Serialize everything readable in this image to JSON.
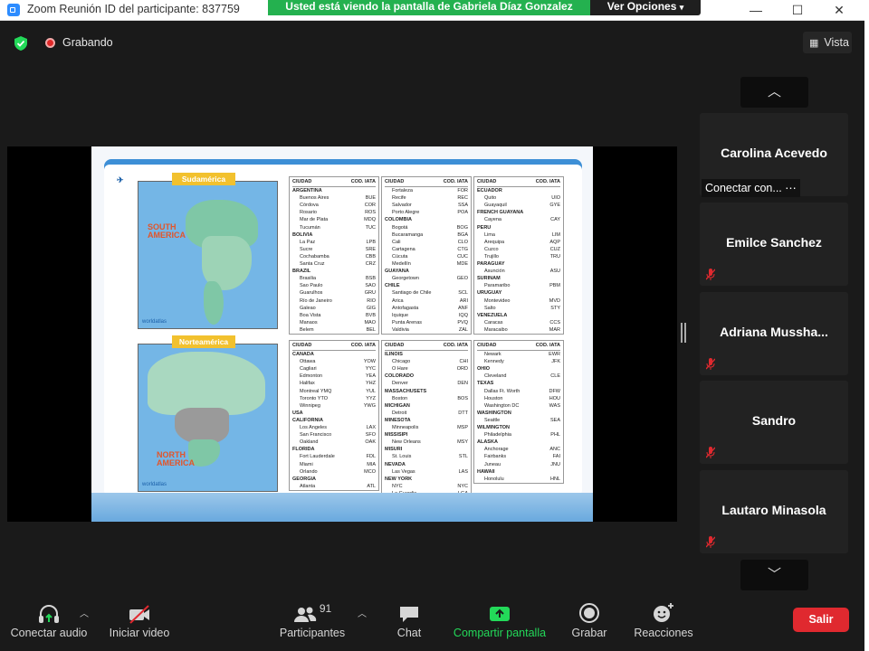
{
  "window": {
    "title": "Zoom Reunión ID del participante: 837759",
    "minimize": "—",
    "maximize": "☐",
    "close": "✕"
  },
  "share_banner": {
    "text": "Usted está viendo la pantalla de Gabriela Díaz Gonzalez",
    "view_options": "Ver Opciones"
  },
  "top": {
    "recording_label": "Grabando",
    "view_label": "Vista"
  },
  "slide": {
    "map_sa_tag": "Sudamérica",
    "map_sa_name_line1": "SOUTH",
    "map_sa_name_line2": "AMERICA",
    "map_na_tag": "Norteamérica",
    "map_na_name_line1": "NORTH",
    "map_na_name_line2": "AMERICA",
    "worldatlas": "worldatlas",
    "header_city": "CIUDAD",
    "header_code": "COD. IATA",
    "tables": [
      [
        [
          "c",
          "ARGENTINA",
          ""
        ],
        [
          "t",
          "Buenos Aires",
          "BUE"
        ],
        [
          "t",
          "Córdova",
          "COR"
        ],
        [
          "t",
          "Rosario",
          "ROS"
        ],
        [
          "t",
          "Mar de Plata",
          "MDQ"
        ],
        [
          "t",
          "Tucumán",
          "TUC"
        ],
        [
          "c",
          "BOLIVIA",
          ""
        ],
        [
          "t",
          "La Paz",
          "LPB"
        ],
        [
          "t",
          "Sucre",
          "SRE"
        ],
        [
          "t",
          "Cochabamba",
          "CBB"
        ],
        [
          "t",
          "Santa Cruz",
          "CRZ"
        ],
        [
          "c",
          "BRAZIL",
          ""
        ],
        [
          "t",
          "Brasilia",
          "BSB"
        ],
        [
          "t",
          "Sao Paulo",
          "SAO"
        ],
        [
          "t",
          "Guarulhos",
          "GRU"
        ],
        [
          "t",
          "Río de Janeiro",
          "RIO"
        ],
        [
          "t",
          "Galeao",
          "GIG"
        ],
        [
          "t",
          "Boa Vista",
          "BVB"
        ],
        [
          "t",
          "Manaos",
          "MAO"
        ],
        [
          "t",
          "Belem",
          "BEL"
        ]
      ],
      [
        [
          "t",
          "Fortaleza",
          "FOR"
        ],
        [
          "t",
          "Recife",
          "REC"
        ],
        [
          "t",
          "Salvador",
          "SSA"
        ],
        [
          "t",
          "Porto Alegre",
          "POA"
        ],
        [
          "c",
          "COLOMBIA",
          ""
        ],
        [
          "t",
          "Bogotá",
          "BOG"
        ],
        [
          "t",
          "Bucaramanga",
          "BGA"
        ],
        [
          "t",
          "Cali",
          "CLO"
        ],
        [
          "t",
          "Cartagena",
          "CTG"
        ],
        [
          "t",
          "Cúcuta",
          "CUC"
        ],
        [
          "t",
          "Medellín",
          "MDE"
        ],
        [
          "c",
          "GUAYANA",
          ""
        ],
        [
          "t",
          "Georgetown",
          "GEO"
        ],
        [
          "c",
          "CHILE",
          ""
        ],
        [
          "t",
          "Santiago de Chile",
          "SCL"
        ],
        [
          "t",
          "Arica",
          "ARI"
        ],
        [
          "t",
          "Antofagasta",
          "ANF"
        ],
        [
          "t",
          "Iquique",
          "IQQ"
        ],
        [
          "t",
          "Punta Arenas",
          "PVQ"
        ],
        [
          "t",
          "Valdivia",
          "ZAL"
        ]
      ],
      [
        [
          "c",
          "ECUADOR",
          ""
        ],
        [
          "t",
          "Quito",
          "UIO"
        ],
        [
          "t",
          "Guayaquil",
          "GYE"
        ],
        [
          "c",
          "FRENCH GUAYANA",
          ""
        ],
        [
          "t",
          "Cayena",
          "CAY"
        ],
        [
          "c",
          "PERU",
          ""
        ],
        [
          "t",
          "Lima",
          "LIM"
        ],
        [
          "t",
          "Arequipa",
          "AQP"
        ],
        [
          "t",
          "Cuzco",
          "CUZ"
        ],
        [
          "t",
          "Trujillo",
          "TRU"
        ],
        [
          "c",
          "PARAGUAY",
          ""
        ],
        [
          "t",
          "Asunción",
          "ASU"
        ],
        [
          "c",
          "SURINAM",
          ""
        ],
        [
          "t",
          "Paramaribo",
          "PBM"
        ],
        [
          "c",
          "URUGUAY",
          ""
        ],
        [
          "t",
          "Montevideo",
          "MVD"
        ],
        [
          "t",
          "Salto",
          "STY"
        ],
        [
          "c",
          "VENEZUELA",
          ""
        ],
        [
          "t",
          "Caracas",
          "CCS"
        ],
        [
          "t",
          "Maracaibo",
          "MAR"
        ]
      ],
      [
        [
          "c",
          "CANADA",
          ""
        ],
        [
          "t",
          "Ottawa",
          "YOW"
        ],
        [
          "t",
          "Cagliari",
          "YYC"
        ],
        [
          "t",
          "Edmonton",
          "YEA"
        ],
        [
          "t",
          "Halifax",
          "YHZ"
        ],
        [
          "t",
          "Montreal   YMQ",
          "YUL"
        ],
        [
          "t",
          "Toronto   YTO",
          "YYZ"
        ],
        [
          "t",
          "Winnipeg",
          "YWG"
        ],
        [
          "c",
          "USA",
          ""
        ],
        [
          "c",
          "CALIFORNIA",
          ""
        ],
        [
          "t",
          "Los Angeles",
          "LAX"
        ],
        [
          "t",
          "San Francisco",
          "SFO"
        ],
        [
          "t",
          "Oakland",
          "OAK"
        ],
        [
          "c",
          "FLORIDA",
          ""
        ],
        [
          "t",
          "Fort Lauderdale",
          "FDL"
        ],
        [
          "t",
          "Miami",
          "MIA"
        ],
        [
          "t",
          "Orlando",
          "MCO"
        ],
        [
          "c",
          "GEORGIA",
          ""
        ],
        [
          "t",
          "Atlanta",
          "ATL"
        ]
      ],
      [
        [
          "c",
          "ILINOIS",
          ""
        ],
        [
          "t",
          "Chicago",
          "CHI"
        ],
        [
          "t",
          "O Hare",
          "ORD"
        ],
        [
          "c",
          "COLORADO",
          ""
        ],
        [
          "t",
          "Denver",
          "DEN"
        ],
        [
          "c",
          "MASSACHUSETS",
          ""
        ],
        [
          "t",
          "Boston",
          "BOS"
        ],
        [
          "c",
          "MICHIGAN",
          ""
        ],
        [
          "t",
          "Detroit",
          "DTT"
        ],
        [
          "c",
          "MINESOTA",
          ""
        ],
        [
          "t",
          "Minneapolis",
          "MSP"
        ],
        [
          "c",
          "MISSISIPI",
          ""
        ],
        [
          "t",
          "New Orleans",
          "MSY"
        ],
        [
          "c",
          "MISURI",
          ""
        ],
        [
          "t",
          "St. Louis",
          "STL"
        ],
        [
          "c",
          "NEVADA",
          ""
        ],
        [
          "t",
          "Las Vegas",
          "LAS"
        ],
        [
          "c",
          "NEW YORK",
          ""
        ],
        [
          "t",
          "NYC",
          "NYC"
        ],
        [
          "t",
          "La Guardia",
          "LGA"
        ]
      ],
      [
        [
          "t",
          "Newark",
          "EWR"
        ],
        [
          "t",
          "Kennedy",
          "JFK"
        ],
        [
          "c",
          "OHIO",
          ""
        ],
        [
          "t",
          "Cleveland",
          "CLE"
        ],
        [
          "c",
          "TEXAS",
          ""
        ],
        [
          "t",
          "Dallas Ft. Worth",
          "DFW"
        ],
        [
          "t",
          "Houston",
          "HOU"
        ],
        [
          "t",
          "Washington DC",
          "WAS"
        ],
        [
          "c",
          "WASHINGTON",
          ""
        ],
        [
          "t",
          "Seattle",
          "SEA"
        ],
        [
          "c",
          "WILMINGTON",
          ""
        ],
        [
          "t",
          "Philadelphia",
          "PHL"
        ],
        [
          "c",
          "ALASKA",
          ""
        ],
        [
          "t",
          "Anchorage",
          "ANC"
        ],
        [
          "t",
          "Fairbanks",
          "FAI"
        ],
        [
          "t",
          "Juneau",
          "JNU"
        ],
        [
          "c",
          "HAWAII",
          ""
        ],
        [
          "t",
          "Honolulu",
          "HNL"
        ]
      ]
    ]
  },
  "participants": [
    {
      "name": "Carolina Acevedo",
      "status": "Conectar con... ⋯",
      "muted": false
    },
    {
      "name": "Emilce Sanchez",
      "muted": true
    },
    {
      "name": "Adriana  Mussha...",
      "muted": true
    },
    {
      "name": "Sandro",
      "muted": true
    },
    {
      "name": "Lautaro Minasola",
      "muted": true
    }
  ],
  "toolbar": {
    "audio": "Conectar audio",
    "video": "Iniciar video",
    "participants": "Participantes",
    "participants_count": "91",
    "chat": "Chat",
    "share": "Compartir pantalla",
    "record": "Grabar",
    "reactions": "Reacciones",
    "leave": "Salir"
  },
  "colors": {
    "share_green": "#24b14f",
    "leave_red": "#e0292f",
    "muted_red": "#e0292f"
  }
}
